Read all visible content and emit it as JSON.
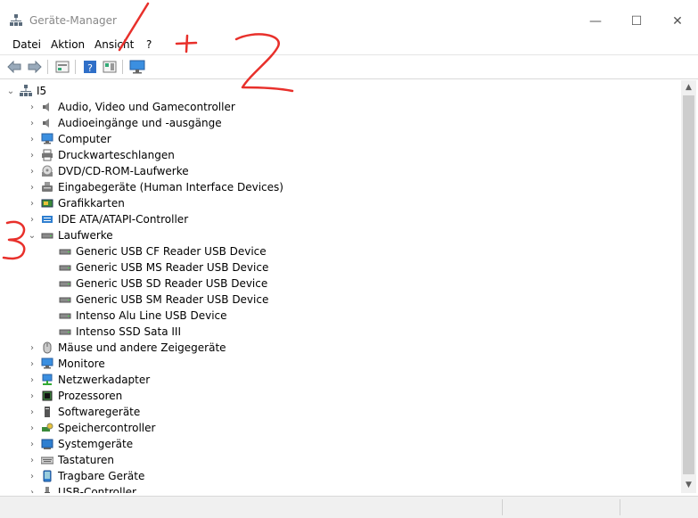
{
  "window": {
    "title": "Geräte-Manager",
    "minimize": "—",
    "maximize": "☐",
    "close": "✕"
  },
  "menu": [
    "Datei",
    "Aktion",
    "Ansicht",
    "?"
  ],
  "toolbar": [
    "back-icon",
    "forward-icon",
    "properties-icon",
    "help-icon",
    "driver-details-icon",
    "monitor-icon"
  ],
  "tree": {
    "root": "I5",
    "categories": [
      {
        "label": "Audio, Video und Gamecontroller",
        "icon": "speaker-icon"
      },
      {
        "label": "Audioeingänge und -ausgänge",
        "icon": "speaker-icon"
      },
      {
        "label": "Computer",
        "icon": "computer-icon"
      },
      {
        "label": "Druckwarteschlangen",
        "icon": "printer-icon"
      },
      {
        "label": "DVD/CD-ROM-Laufwerke",
        "icon": "disc-icon"
      },
      {
        "label": "Eingabegeräte (Human Interface Devices)",
        "icon": "hid-icon"
      },
      {
        "label": "Grafikkarten",
        "icon": "display-adapter-icon"
      },
      {
        "label": "IDE ATA/ATAPI-Controller",
        "icon": "ide-icon"
      },
      {
        "label": "Laufwerke",
        "icon": "drive-icon",
        "expanded": true,
        "children": [
          "Generic USB CF Reader USB Device",
          "Generic USB MS Reader USB Device",
          "Generic USB SD Reader USB Device",
          "Generic USB SM Reader USB Device",
          "Intenso Alu Line USB Device",
          "Intenso SSD Sata III"
        ]
      },
      {
        "label": "Mäuse und andere Zeigegeräte",
        "icon": "mouse-icon"
      },
      {
        "label": "Monitore",
        "icon": "monitor-icon"
      },
      {
        "label": "Netzwerkadapter",
        "icon": "network-icon"
      },
      {
        "label": "Prozessoren",
        "icon": "processor-icon"
      },
      {
        "label": "Softwaregeräte",
        "icon": "software-device-icon"
      },
      {
        "label": "Speichercontroller",
        "icon": "storage-controller-icon"
      },
      {
        "label": "Systemgeräte",
        "icon": "system-device-icon"
      },
      {
        "label": "Tastaturen",
        "icon": "keyboard-icon"
      },
      {
        "label": "Tragbare Geräte",
        "icon": "portable-device-icon"
      },
      {
        "label": "USB-Controller",
        "icon": "usb-icon"
      }
    ]
  },
  "annotations": [
    "1",
    "+",
    "2",
    "3"
  ],
  "colors": {
    "annotation": "#e8302b",
    "accent": "#2f7fd0",
    "scrollThumb": "#cdcdcd"
  }
}
